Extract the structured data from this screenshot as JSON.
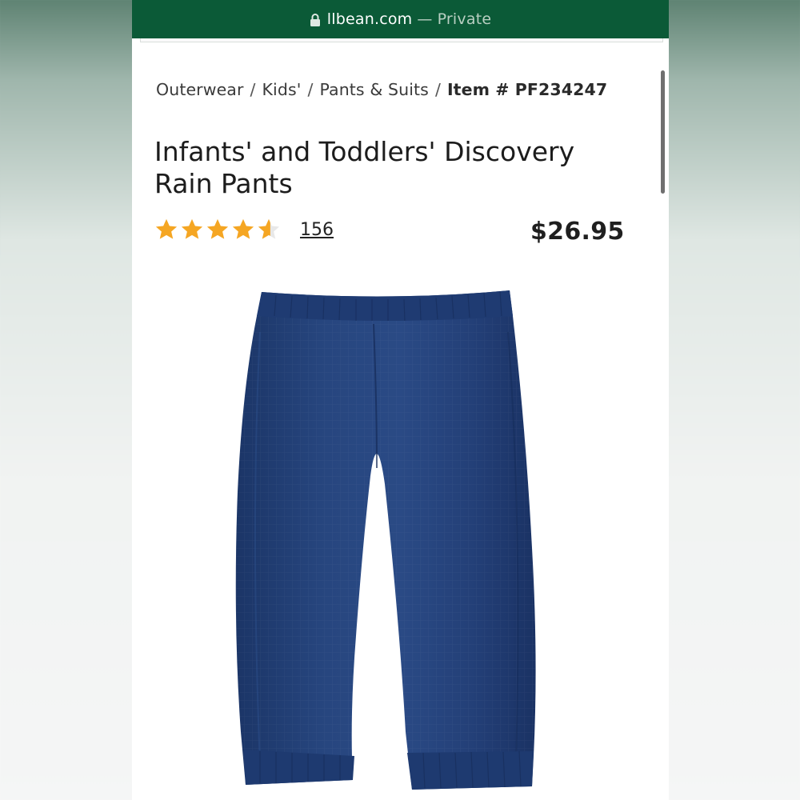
{
  "browser": {
    "url_host": "llbean.com",
    "url_separator": "—",
    "url_mode": "Private",
    "bar_color": "#0b5a37"
  },
  "breadcrumb": {
    "items": [
      "Outerwear",
      "Kids'",
      "Pants & Suits"
    ],
    "separator": "/",
    "item_number": "Item # PF234247"
  },
  "product": {
    "title": "Infants' and Toddlers' Discovery Rain Pants",
    "rating_value": 4.6,
    "rating_max": 5,
    "review_count": "156",
    "price": "$26.95",
    "star_color": "#f5a623",
    "image_color": "#23407a",
    "image_alt": "product-photo"
  }
}
